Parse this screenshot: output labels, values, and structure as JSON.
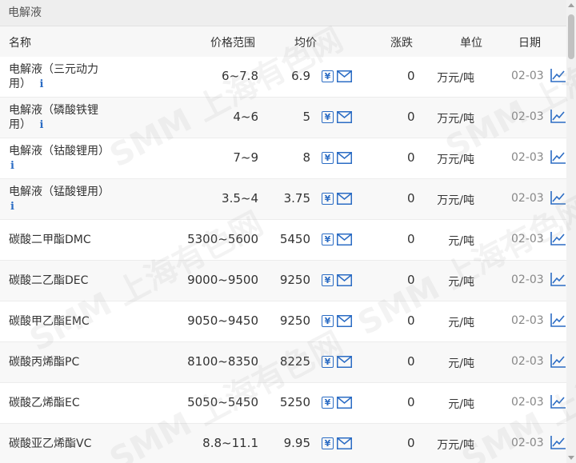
{
  "section": {
    "title": "电解液"
  },
  "columns": {
    "name": "名称",
    "range": "价格范围",
    "avg": "均价",
    "change": "涨跌",
    "unit": "单位",
    "date": "日期"
  },
  "rows": [
    {
      "name": "电解液（三元动力用）",
      "name_line1": "电解液（三元动力",
      "name_line2": "用）",
      "info": "i",
      "range": "6~7.8",
      "avg": "6.9",
      "change": "0",
      "unit": "万元/吨",
      "date": "02-03"
    },
    {
      "name": "电解液（磷酸铁锂用）",
      "name_line1": "电解液（磷酸铁锂",
      "name_line2": "用）",
      "info": "i",
      "range": "4~6",
      "avg": "5",
      "change": "0",
      "unit": "万元/吨",
      "date": "02-03"
    },
    {
      "name": "电解液（钴酸锂用）",
      "name_line1": "电解液（钴酸锂用）",
      "name_line2": "",
      "info": "i",
      "range": "7~9",
      "avg": "8",
      "change": "0",
      "unit": "万元/吨",
      "date": "02-03"
    },
    {
      "name": "电解液（锰酸锂用）",
      "name_line1": "电解液（锰酸锂用）",
      "name_line2": "",
      "info": "i",
      "range": "3.5~4",
      "avg": "3.75",
      "change": "0",
      "unit": "万元/吨",
      "date": "02-03"
    },
    {
      "name": "碳酸二甲酯DMC",
      "name_line1": "碳酸二甲酯DMC",
      "name_line2": "",
      "info": "",
      "range": "5300~5600",
      "avg": "5450",
      "change": "0",
      "unit": "元/吨",
      "date": "02-03"
    },
    {
      "name": "碳酸二乙酯DEC",
      "name_line1": "碳酸二乙酯DEC",
      "name_line2": "",
      "info": "",
      "range": "9000~9500",
      "avg": "9250",
      "change": "0",
      "unit": "元/吨",
      "date": "02-03"
    },
    {
      "name": "碳酸甲乙酯EMC",
      "name_line1": "碳酸甲乙酯EMC",
      "name_line2": "",
      "info": "",
      "range": "9050~9450",
      "avg": "9250",
      "change": "0",
      "unit": "元/吨",
      "date": "02-03"
    },
    {
      "name": "碳酸丙烯酯PC",
      "name_line1": "碳酸丙烯酯PC",
      "name_line2": "",
      "info": "",
      "range": "8100~8350",
      "avg": "8225",
      "change": "0",
      "unit": "元/吨",
      "date": "02-03"
    },
    {
      "name": "碳酸乙烯酯EC",
      "name_line1": "碳酸乙烯酯EC",
      "name_line2": "",
      "info": "",
      "range": "5050~5450",
      "avg": "5250",
      "change": "0",
      "unit": "元/吨",
      "date": "02-03"
    },
    {
      "name": "碳酸亚乙烯酯VC",
      "name_line1": "碳酸亚乙烯酯VC",
      "name_line2": "",
      "info": "",
      "range": "8.8~11.1",
      "avg": "9.95",
      "change": "0",
      "unit": "万元/吨",
      "date": "02-03"
    }
  ],
  "icons": {
    "yen": "yen-icon",
    "mail": "mail-icon",
    "chart": "line-chart-icon",
    "info": "info-icon"
  },
  "watermark": {
    "text": "SMM 上海有色网"
  },
  "colors": {
    "accent": "#2b6cc4",
    "header_bg": "#eeeeee",
    "alt_row": "#f8f8f8"
  }
}
